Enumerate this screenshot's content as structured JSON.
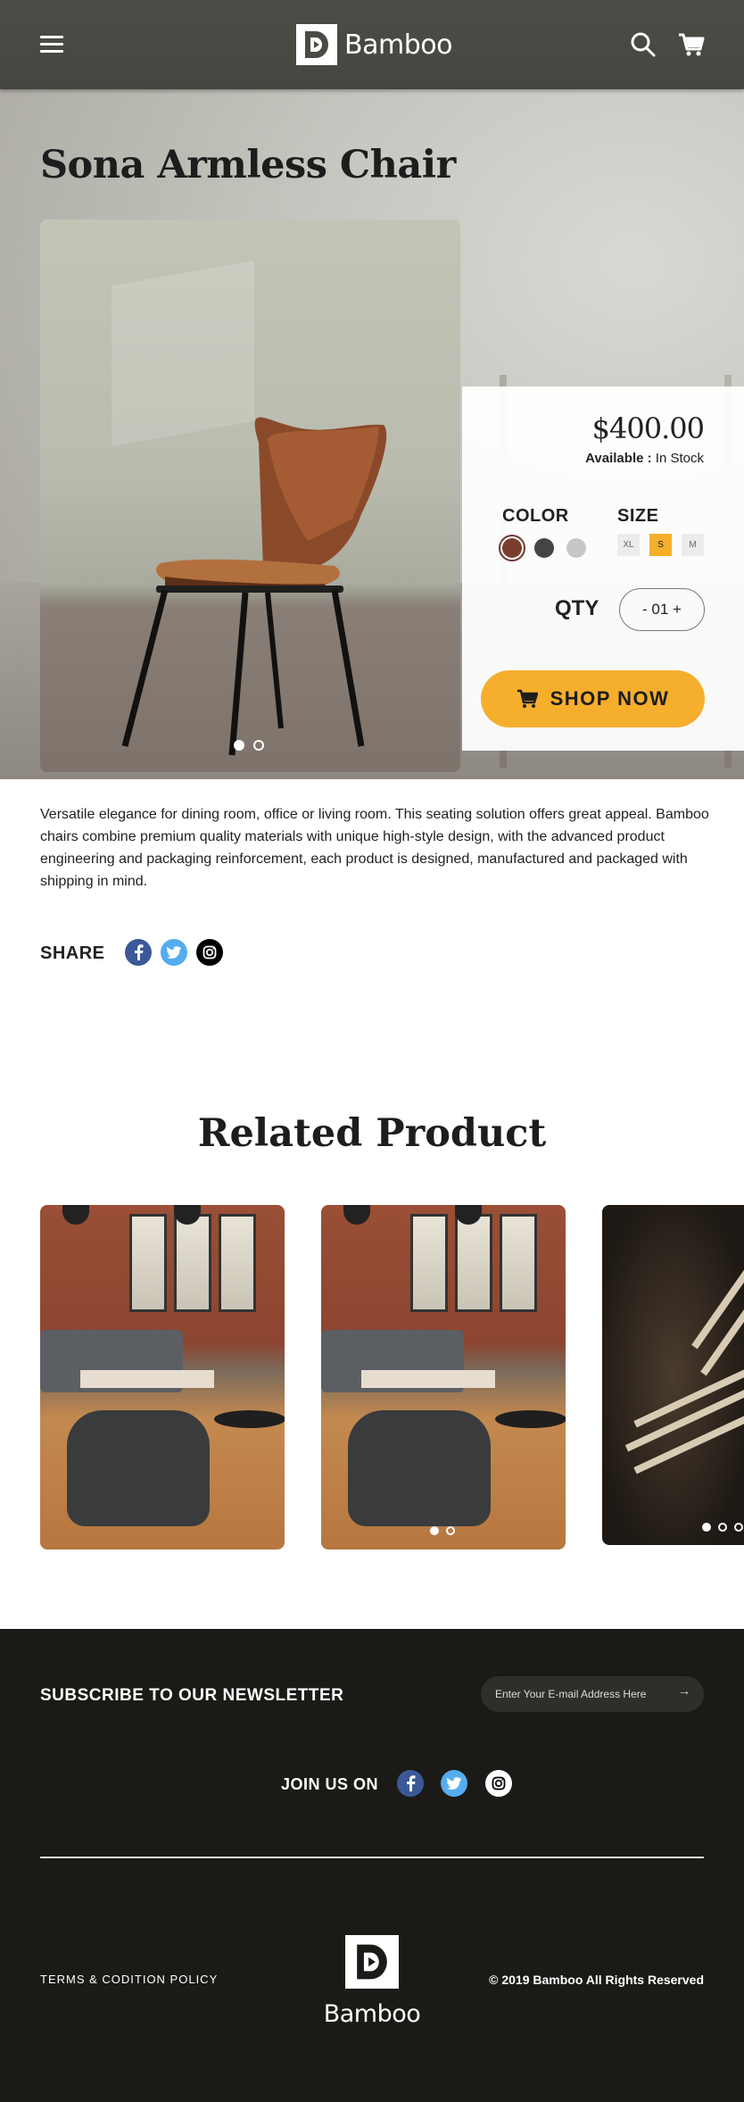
{
  "header": {
    "brand": "Bamboo",
    "icons": {
      "menu": "hamburger-menu-icon",
      "search": "search-icon",
      "cart": "cart-icon"
    }
  },
  "product": {
    "title": "Sona Armless Chair",
    "price": "$400.00",
    "availability_label": "Available :",
    "availability_value": "In Stock",
    "color_label": "COLOR",
    "colors": [
      "#7b3e2d",
      "#444444",
      "#c7c7c7"
    ],
    "selected_color": "#7b3e2d",
    "size_label": "SIZE",
    "sizes": [
      "XL",
      "S",
      "M"
    ],
    "selected_size": "S",
    "qty_label": "QTY",
    "qty_value": "- 01 +",
    "shop_button": "SHOP NOW",
    "carousel_slides": 2,
    "carousel_active": 1,
    "description": "Versatile elegance for dining room, office or living room. This seating solution offers great appeal. Bamboo chairs combine premium quality materials with unique high-style design, with the advanced product engineering and packaging reinforcement, each product is designed, manufactured and packaged with shipping in mind."
  },
  "share": {
    "label": "SHARE",
    "networks": [
      "facebook-icon",
      "twitter-icon",
      "instagram-icon"
    ]
  },
  "related": {
    "title": "Related Product"
  },
  "footer": {
    "newsletter_label": "SUBSCRIBE TO OUR NEWSLETTER",
    "email_placeholder": "Enter Your E-mail Address Here",
    "join_label": "JOIN US ON",
    "terms": "TERMS & CODITION POLICY",
    "brand": "Bamboo",
    "copyright": "© 2019 Bamboo All Rights Reserved"
  },
  "colors": {
    "header_bg": "#4a4944",
    "accent": "#f6ae2d",
    "footer_bg": "#1b1a16",
    "facebook": "#3b5998",
    "twitter": "#55acee",
    "instagram": "#000000"
  }
}
